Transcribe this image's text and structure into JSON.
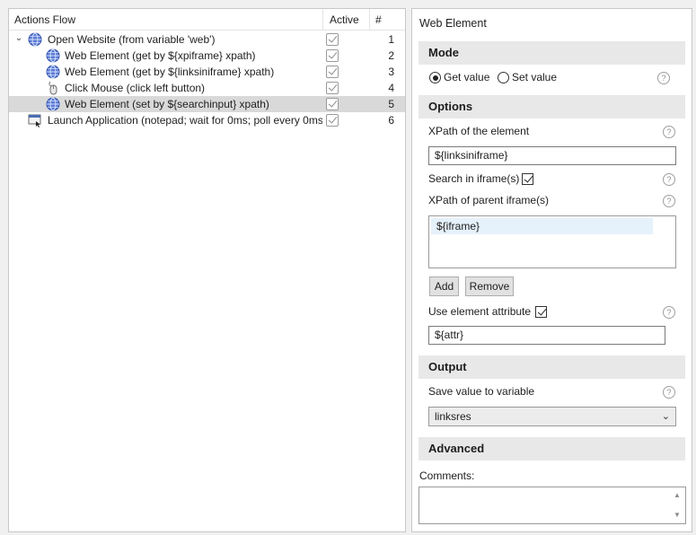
{
  "actions_flow": {
    "header": {
      "name": "Actions Flow",
      "active": "Active",
      "num": "#"
    },
    "rows": [
      {
        "label": "Open Website (from variable 'web')",
        "num": "1",
        "icon": "globe-icon",
        "expander": "⌄"
      },
      {
        "label": "Web Element (get by ${xpiframe} xpath)",
        "num": "2",
        "icon": "globe-icon"
      },
      {
        "label": "Web Element (get by ${linksiniframe} xpath)",
        "num": "3",
        "icon": "globe-icon"
      },
      {
        "label": "Click Mouse (click left button)",
        "num": "4",
        "icon": "mouse-icon"
      },
      {
        "label": "Web Element (set by ${searchinput} xpath)",
        "num": "5",
        "icon": "globe-icon",
        "selected": true
      },
      {
        "label": "Launch Application (notepad; wait for 0ms; poll every 0ms",
        "num": "6",
        "icon": "application-icon"
      }
    ]
  },
  "web_element": {
    "title": "Web Element",
    "mode": {
      "header": "Mode",
      "get_value": "Get value",
      "set_value": "Set value",
      "selected": "get"
    },
    "options": {
      "header": "Options",
      "xpath_label": "XPath of the element",
      "xpath_value": "${linksiniframe}",
      "search_iframe_label": "Search in iframe(s)",
      "search_iframe_checked": true,
      "parent_iframe_label": "XPath of parent iframe(s)",
      "iframe_items": [
        "${iframe}"
      ],
      "add_button": "Add",
      "remove_button": "Remove",
      "use_attribute_label": "Use element attribute",
      "use_attribute_checked": true,
      "attribute_value": "${attr}"
    },
    "output": {
      "header": "Output",
      "save_label": "Save value to variable",
      "variable": "linksres"
    },
    "advanced": {
      "header": "Advanced"
    },
    "comments": {
      "label": "Comments:",
      "value": ""
    }
  },
  "help_glyph": "?"
}
